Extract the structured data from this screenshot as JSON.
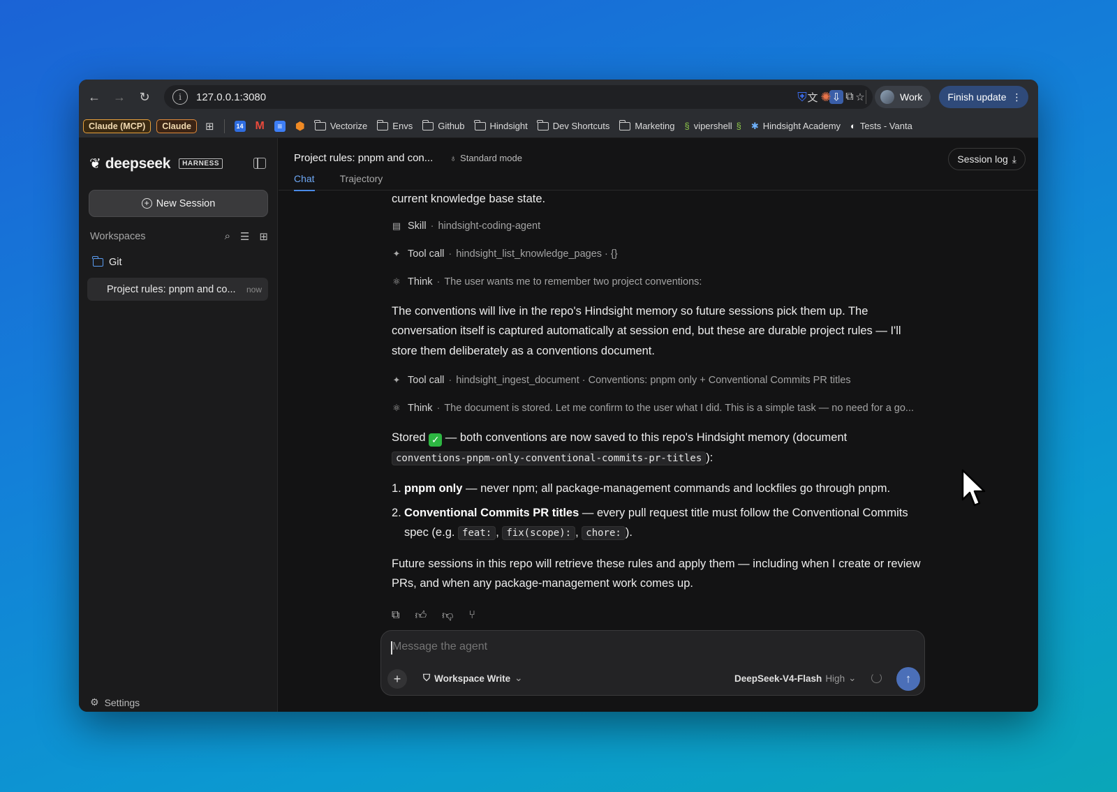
{
  "browser": {
    "url": "127.0.0.1:3080",
    "profile_label": "Work",
    "update_label": "Finish update",
    "bookmarks": [
      {
        "type": "pill",
        "label": "Claude (MCP)"
      },
      {
        "type": "pill",
        "label": "Claude"
      },
      {
        "type": "folder",
        "label": "Vectorize"
      },
      {
        "type": "folder",
        "label": "Envs"
      },
      {
        "type": "folder",
        "label": "Github"
      },
      {
        "type": "folder",
        "label": "Hindsight"
      },
      {
        "type": "folder",
        "label": "Dev Shortcuts"
      },
      {
        "type": "folder",
        "label": "Marketing"
      },
      {
        "type": "link",
        "label": "vipershell"
      },
      {
        "type": "link",
        "label": "Hindsight Academy"
      },
      {
        "type": "link",
        "label": "Tests - Vanta"
      }
    ],
    "calendar_badge": "14"
  },
  "sidebar": {
    "brand_name": "deepseek",
    "brand_tag": "HARNESS",
    "new_session_label": "New Session",
    "workspaces_title": "Workspaces",
    "workspace_name": "Git",
    "session": {
      "title": "Project rules: pnpm and co...",
      "time": "now"
    },
    "settings_label": "Settings"
  },
  "header": {
    "title": "Project rules: pnpm and con...",
    "mode": "Standard mode",
    "tabs": [
      "Chat",
      "Trajectory"
    ],
    "session_log_label": "Session log"
  },
  "chat": {
    "intro_tail": "current knowledge base state.",
    "step1": {
      "kind": "Skill",
      "detail": "hindsight-coding-agent"
    },
    "step2": {
      "kind": "Tool call",
      "detail": "hindsight_list_knowledge_pages · {}"
    },
    "step3": {
      "kind": "Think",
      "detail": "The user wants me to remember two project conventions:"
    },
    "para1": "The conventions will live in the repo's Hindsight memory so future sessions pick them up. The conversation itself is captured automatically at session end, but these are durable project rules — I'll store them deliberately as a conventions document.",
    "step4": {
      "kind": "Tool call",
      "detail": "hindsight_ingest_document · Conventions: pnpm only + Conventional Commits PR titles"
    },
    "step5": {
      "kind": "Think",
      "detail": "The document is stored. Let me confirm to the user what I did. This is a simple task — no need for a go..."
    },
    "stored_word": "Stored",
    "stored_rest": " — both conventions are now saved to this repo's Hindsight memory (document",
    "doc_id": "conventions-pnpm-only-conventional-commits-pr-titles",
    "doc_tail": "):",
    "rules": [
      {
        "num": "1.",
        "bold": "pnpm only",
        "text": " — never npm; all package-management commands and lockfiles go through pnpm."
      },
      {
        "num": "2.",
        "bold": "Conventional Commits PR titles",
        "text": " — every pull request title must follow the Conventional Commits spec (e.g. "
      }
    ],
    "codes": [
      "feat:",
      "fix(scope):",
      "chore:"
    ],
    "rule2_end": ").",
    "para_final": "Future sessions in this repo will retrieve these rules and apply them — including when I create or review PRs, and when any package-management work comes up."
  },
  "composer": {
    "placeholder": "Message the agent",
    "workspace_mode": "Workspace Write",
    "model": "DeepSeek-V4-Flash",
    "effort": "High"
  }
}
